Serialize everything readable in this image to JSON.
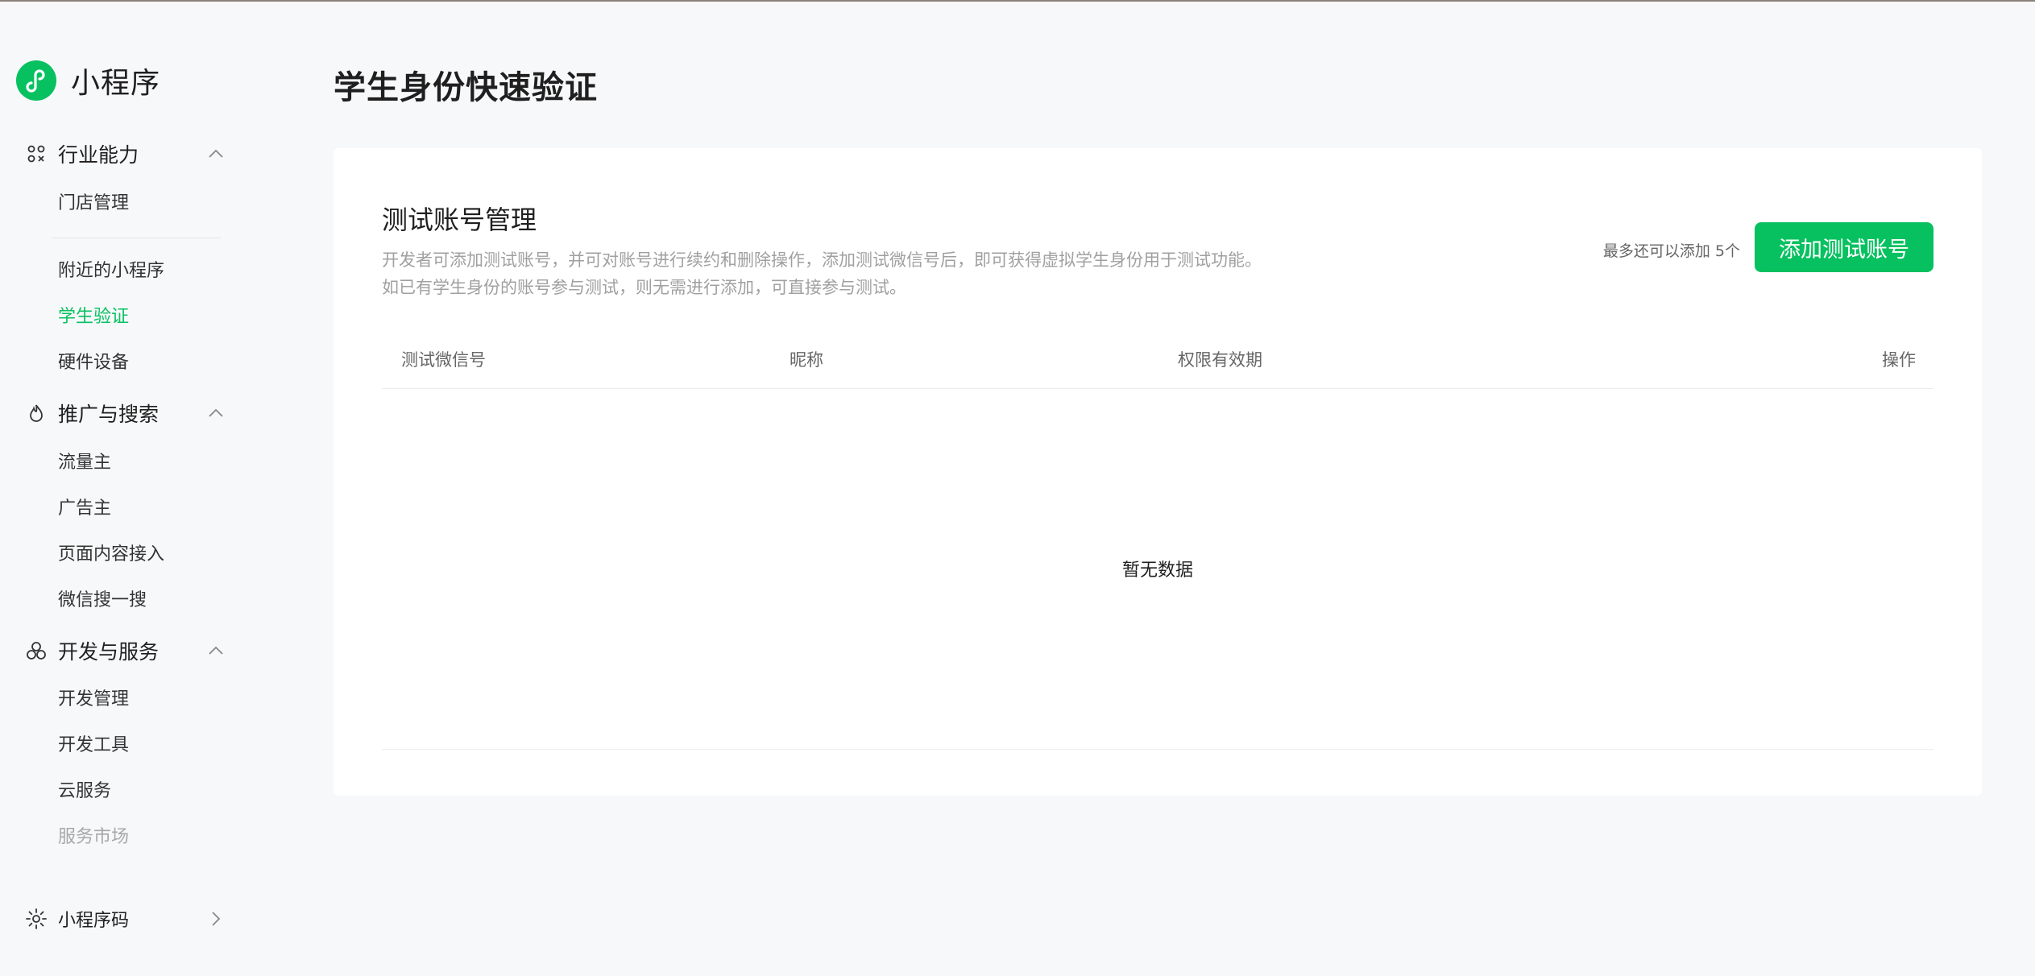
{
  "brand": {
    "title": "小程序",
    "logo_icon": "miniprogram-logo-icon",
    "accent": "#07c160"
  },
  "sidebar": {
    "groups": [
      {
        "label": "行业能力",
        "icon": "industry-icon",
        "chevron": "chevron-up-icon",
        "items": [
          {
            "label": "门店管理"
          },
          {
            "label": "附近的小程序"
          },
          {
            "label": "学生验证",
            "active": true
          },
          {
            "label": "硬件设备"
          }
        ]
      },
      {
        "label": "推广与搜索",
        "icon": "flame-icon",
        "chevron": "chevron-up-icon",
        "items": [
          {
            "label": "流量主"
          },
          {
            "label": "广告主"
          },
          {
            "label": "页面内容接入"
          },
          {
            "label": "微信搜一搜"
          }
        ]
      },
      {
        "label": "开发与服务",
        "icon": "cluster-icon",
        "chevron": "chevron-up-icon",
        "items": [
          {
            "label": "开发管理"
          },
          {
            "label": "开发工具"
          },
          {
            "label": "云服务"
          },
          {
            "label": "服务市场",
            "muted": true
          }
        ]
      },
      {
        "label": "小程序码",
        "icon": "sun-icon",
        "chevron": "chevron-right-icon",
        "items": []
      }
    ]
  },
  "main": {
    "page_title": "学生身份快速验证",
    "card": {
      "title": "测试账号管理",
      "desc_line1": "开发者可添加测试账号，并可对账号进行续约和删除操作，添加测试微信号后，即可获得虚拟学生身份用于测试功能。",
      "desc_line2": "如已有学生身份的账号参与测试，则无需进行添加，可直接参与测试。",
      "limit_note": "最多还可以添加 5个",
      "add_button": "添加测试账号",
      "table": {
        "columns": [
          "测试微信号",
          "昵称",
          "权限有效期",
          "操作"
        ],
        "empty_text": "暂无数据"
      }
    }
  }
}
